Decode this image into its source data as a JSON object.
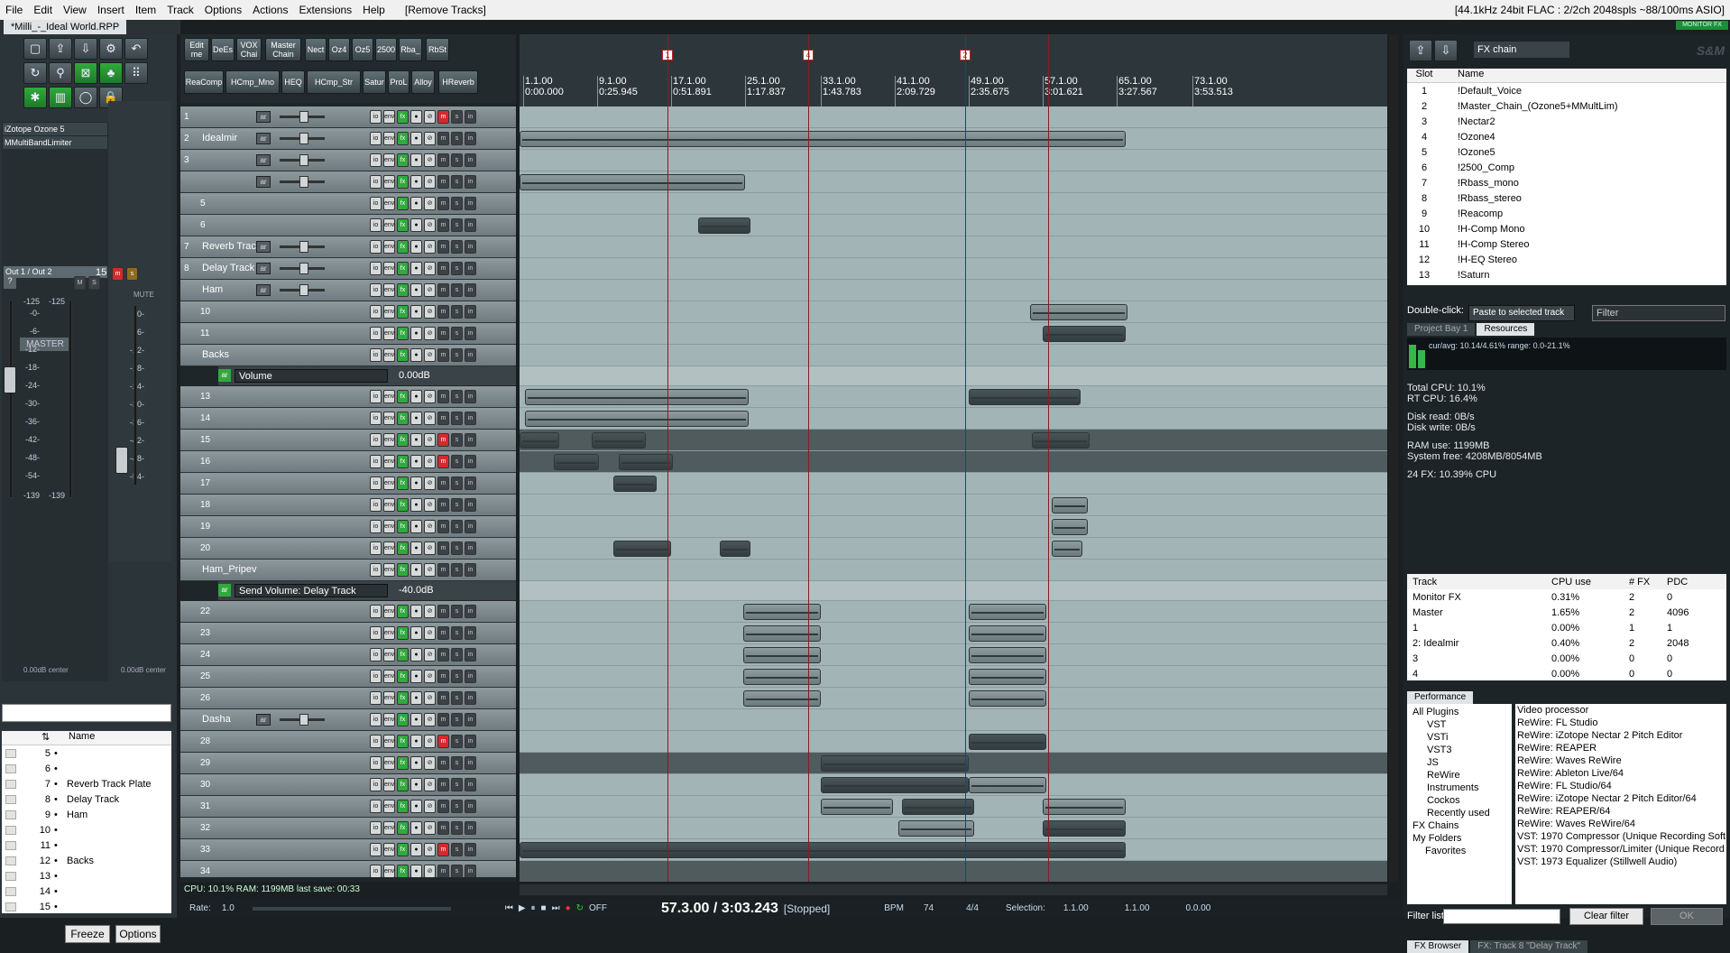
{
  "menu": {
    "items": [
      "File",
      "Edit",
      "View",
      "Insert",
      "Item",
      "Track",
      "Options",
      "Actions",
      "Extensions",
      "Help"
    ],
    "action": "[Remove Tracks]",
    "status": "[44.1kHz 24bit FLAC : 2/2ch 2048spls ~88/100ms ASIO]"
  },
  "project": {
    "tab": "*Milli_-_Ideal World.RPP",
    "monitor_fx": "MONITOR FX"
  },
  "master": {
    "fx": [
      "iZotope Ozone 5",
      "MMultiBandLimiter"
    ],
    "output": "Out 1 / Out 2",
    "label": "MASTER",
    "trackcount": "15",
    "db_scale": [
      "-125",
      "-0-",
      "-6-",
      "-12-",
      "-18-",
      "-24-",
      "-30-",
      "-36-",
      "-42-",
      "-48-",
      "-54-",
      "-139"
    ],
    "db_right": [
      "-125",
      "-0-",
      "-6-",
      "-12-",
      "-18-",
      "-24-",
      "-30-",
      "-36-",
      "-42-",
      "-48-",
      "-54-",
      "-139"
    ],
    "center_left": "0.00dB center",
    "center_right": "0.00dB center",
    "mute": "MUTE"
  },
  "fx_toolbar": [
    {
      "label": "Edit me"
    },
    {
      "label": "DeEs"
    },
    {
      "label": "VOX Chai"
    },
    {
      "label": "Master Chain"
    },
    {
      "label": "Nect"
    },
    {
      "label": "Oz4"
    },
    {
      "label": "Oz5"
    },
    {
      "label": "2500"
    },
    {
      "label": "Rba_"
    },
    {
      "label": "RbSt"
    },
    {
      "label": "ReaComp"
    },
    {
      "label": "HCmp_Mno"
    },
    {
      "label": "HEQ"
    },
    {
      "label": "HCmp_Str"
    },
    {
      "label": "Satur"
    },
    {
      "label": "ProL"
    },
    {
      "label": "Alloy"
    },
    {
      "label": "HReverb"
    }
  ],
  "tracks": [
    {
      "num": "1",
      "name": ""
    },
    {
      "num": "2",
      "name": "Idealmir"
    },
    {
      "num": "3",
      "name": ""
    },
    {
      "num": "",
      "name": ""
    },
    {
      "num": "5",
      "name": ""
    },
    {
      "num": "6",
      "name": ""
    },
    {
      "num": "7",
      "name": "Reverb Track"
    },
    {
      "num": "8",
      "name": "Delay Track"
    },
    {
      "num": "",
      "name": "Ham"
    },
    {
      "num": "10",
      "name": ""
    },
    {
      "num": "11",
      "name": ""
    },
    {
      "num": "",
      "name": "Backs"
    },
    {
      "num": "",
      "name": "Volume",
      "env": "0.00dB"
    },
    {
      "num": "13",
      "name": ""
    },
    {
      "num": "14",
      "name": ""
    },
    {
      "num": "15",
      "name": ""
    },
    {
      "num": "16",
      "name": ""
    },
    {
      "num": "17",
      "name": ""
    },
    {
      "num": "18",
      "name": ""
    },
    {
      "num": "19",
      "name": ""
    },
    {
      "num": "20",
      "name": ""
    },
    {
      "num": "",
      "name": "Ham_Pripev"
    },
    {
      "num": "",
      "name": "Send Volume: Delay Track",
      "env": "-40.0dB"
    },
    {
      "num": "22",
      "name": ""
    },
    {
      "num": "23",
      "name": ""
    },
    {
      "num": "24",
      "name": ""
    },
    {
      "num": "25",
      "name": ""
    },
    {
      "num": "26",
      "name": ""
    },
    {
      "num": "",
      "name": "Dasha"
    },
    {
      "num": "28",
      "name": ""
    },
    {
      "num": "29",
      "name": ""
    },
    {
      "num": "30",
      "name": ""
    },
    {
      "num": "31",
      "name": ""
    },
    {
      "num": "32",
      "name": ""
    },
    {
      "num": "33",
      "name": ""
    },
    {
      "num": "34",
      "name": ""
    }
  ],
  "ruler": {
    "bars": [
      "1.1.00",
      "9.1.00",
      "17.1.00",
      "25.1.00",
      "33.1.00",
      "41.1.00",
      "49.1.00",
      "57.1.00",
      "65.1.00",
      "73.1.00"
    ],
    "times": [
      "0:00.000",
      "0:25.945",
      "0:51.891",
      "1:17.837",
      "1:43.783",
      "2:09.729",
      "2:35.675",
      "3:01.621",
      "3:27.567",
      "3:53.513"
    ],
    "markers": [
      "1",
      "4",
      "2"
    ]
  },
  "tracklist": {
    "header": "Name",
    "rows": [
      {
        "n": "5",
        "name": ""
      },
      {
        "n": "6",
        "name": ""
      },
      {
        "n": "7",
        "name": "Reverb Track Plate"
      },
      {
        "n": "8",
        "name": "Delay Track"
      },
      {
        "n": "9",
        "name": "Ham"
      },
      {
        "n": "10",
        "name": ""
      },
      {
        "n": "11",
        "name": ""
      },
      {
        "n": "12",
        "name": "Backs"
      },
      {
        "n": "13",
        "name": ""
      },
      {
        "n": "14",
        "name": ""
      },
      {
        "n": "15",
        "name": ""
      }
    ],
    "freeze": "Freeze",
    "options": "Options"
  },
  "cpu_status": "CPU: 10.1%  RAM: 1199MB  last save: 00:33",
  "transport": {
    "rate_label": "Rate:",
    "rate": "1.0",
    "time": "57.3.00 / 3:03.243",
    "state": "[Stopped]",
    "bpm_label": "BPM",
    "bpm": "74",
    "sig": "4/4",
    "sel_label": "Selection:",
    "sel_start": "1.1.00",
    "sel_end": "1.1.00",
    "sel_len": "0.0.00",
    "off": "OFF"
  },
  "resources": {
    "fxchain": "FX chain",
    "brand": "S&M",
    "slot_header": "Slot",
    "name_header": "Name",
    "slots": [
      {
        "n": "1",
        "name": "!Default_Voice"
      },
      {
        "n": "2",
        "name": "!Master_Chain_(Ozone5+MMultLim)"
      },
      {
        "n": "3",
        "name": "!Nectar2"
      },
      {
        "n": "4",
        "name": "!Ozone4"
      },
      {
        "n": "5",
        "name": "!Ozone5"
      },
      {
        "n": "6",
        "name": "!2500_Comp"
      },
      {
        "n": "7",
        "name": "!Rbass_mono"
      },
      {
        "n": "8",
        "name": "!Rbass_stereo"
      },
      {
        "n": "9",
        "name": "!Reacomp"
      },
      {
        "n": "10",
        "name": "!H-Comp Mono"
      },
      {
        "n": "11",
        "name": "!H-Comp Stereo"
      },
      {
        "n": "12",
        "name": "!H-EQ Stereo"
      },
      {
        "n": "13",
        "name": "!Saturn"
      }
    ],
    "dblclick_label": "Double-click:",
    "dblclick_value": "Paste to selected track",
    "filter": "Filter",
    "tabs": [
      "Project Bay 1",
      "Resources"
    ]
  },
  "performance": {
    "graph": "cur/avg: 10.14/4.61%  range: 0.0-21.1%",
    "total_cpu": "Total CPU: 10.1%",
    "rt_cpu": "RT CPU: 16.4%",
    "disk_read": "Disk read: 0B/s",
    "disk_write": "Disk write: 0B/s",
    "ram": "RAM use: 1199MB",
    "sysfree": "System free: 4208MB/8054MB",
    "fx": "24 FX: 10.39% CPU",
    "headers": [
      "Track",
      "CPU use",
      "# FX",
      "PDC"
    ],
    "rows": [
      {
        "t": "Monitor FX",
        "c": "0.31%",
        "f": "2",
        "p": "0"
      },
      {
        "t": "Master",
        "c": "1.65%",
        "f": "2",
        "p": "4096"
      },
      {
        "t": "1",
        "c": "0.00%",
        "f": "1",
        "p": "1"
      },
      {
        "t": "2: Idealmir",
        "c": "0.40%",
        "f": "2",
        "p": "2048"
      },
      {
        "t": "3",
        "c": "0.00%",
        "f": "0",
        "p": "0"
      },
      {
        "t": "4",
        "c": "0.00%",
        "f": "0",
        "p": "0"
      }
    ],
    "tab": "Performance"
  },
  "fxbrowser": {
    "tree": [
      "All Plugins",
      "VST",
      "VSTi",
      "VST3",
      "JS",
      "ReWire",
      "Instruments",
      "Cockos",
      "Recently used",
      "FX Chains",
      "My Folders",
      "Favorites"
    ],
    "plugins": [
      "Video processor",
      "ReWire: FL Studio",
      "ReWire: iZotope Nectar 2 Pitch Editor",
      "ReWire: REAPER",
      "ReWire: Waves ReWire",
      "ReWire: Ableton Live/64",
      "ReWire: FL Studio/64",
      "ReWire: iZotope Nectar 2 Pitch Editor/64",
      "ReWire: REAPER/64",
      "ReWire: Waves ReWire/64",
      "VST: 1970 Compressor (Unique Recording Soft",
      "VST: 1970 Compressor/Limiter (Unique Record",
      "VST: 1973 Equalizer (Stillwell Audio)"
    ],
    "filter_label": "Filter list:",
    "clear": "Clear filter",
    "ok": "OK",
    "tabs": [
      "FX Browser",
      "FX: Track 8 \"Delay Track\""
    ]
  }
}
